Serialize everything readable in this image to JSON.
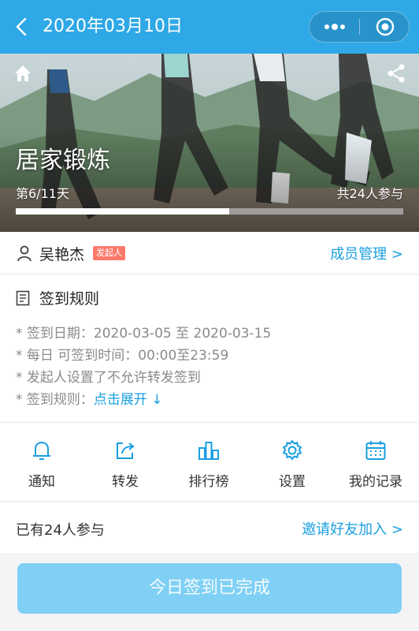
{
  "topbar": {
    "title": "2020年03月10日"
  },
  "hero": {
    "title": "居家锻炼",
    "day_text": "第6/11天",
    "count_text": "共24人参与",
    "progress_fraction": 0.55
  },
  "initiator": {
    "name": "吴艳杰",
    "badge": "发起人",
    "manage_label": "成员管理 >"
  },
  "rules": {
    "title": "签到规则",
    "lines": [
      "* 签到日期：2020-03-05 至 2020-03-15",
      "* 每日 可签到时间：00:00至23:59",
      "* 发起人设置了不允许转发签到"
    ],
    "rule_prefix": "* 签到规则：",
    "expand_label": "点击展开 ↓"
  },
  "actions": [
    {
      "label": "通知",
      "icon": "bell-icon"
    },
    {
      "label": "转发",
      "icon": "share-out-icon"
    },
    {
      "label": "排行榜",
      "icon": "ranking-icon"
    },
    {
      "label": "设置",
      "icon": "gear-icon"
    },
    {
      "label": "我的记录",
      "icon": "calendar-icon"
    }
  ],
  "participants": {
    "text": "已有24人参与",
    "invite_label": "邀请好友加入 >"
  },
  "checkin": {
    "label": "今日签到已完成"
  },
  "colors": {
    "accent": "#2ea8e6",
    "link": "#1a9fe0",
    "button": "#7fd0f4",
    "badge": "#ff7a6b"
  }
}
